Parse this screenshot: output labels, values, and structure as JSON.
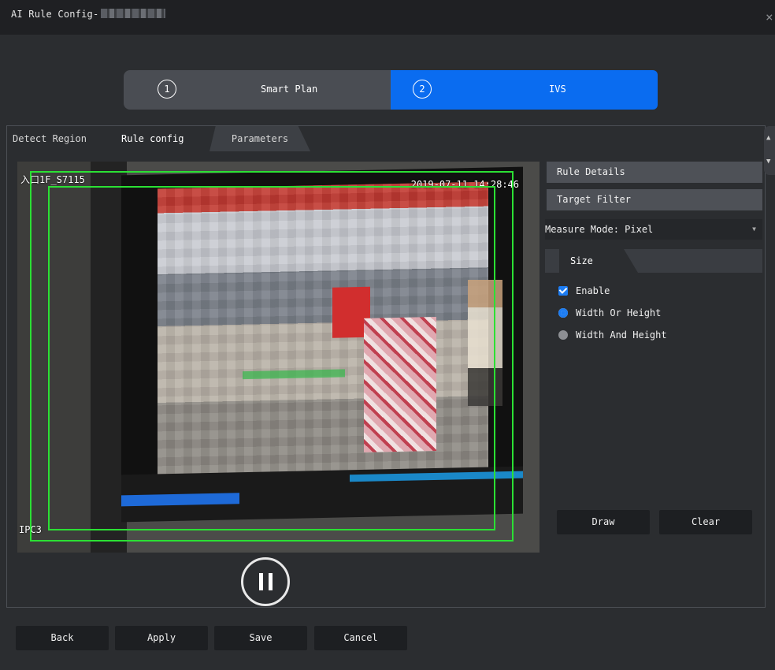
{
  "window": {
    "title": "AI Rule Config-",
    "close_glyph": "×"
  },
  "steps": [
    {
      "number": "1",
      "label": "Smart Plan"
    },
    {
      "number": "2",
      "label": "IVS"
    }
  ],
  "tabs": {
    "detect_region": "Detect Region",
    "rule_config": "Rule config",
    "parameters": "Parameters"
  },
  "video": {
    "osd_left": "入口1F_S7115",
    "osd_right": "2019-07-11 14:28:46",
    "osd_bottom": "IPC3",
    "state": "paused"
  },
  "panel": {
    "rule_details": "Rule Details",
    "target_filter": "Target Filter",
    "measure_mode": "Measure Mode: Pixel",
    "size_tab": "Size",
    "enable_label": "Enable",
    "enable_checked": true,
    "width_or_height_label": "Width Or Height",
    "width_or_height_selected": true,
    "width_and_height_label": "Width And Height",
    "width_and_height_selected": false,
    "draw_label": "Draw",
    "clear_label": "Clear"
  },
  "footer": {
    "back": "Back",
    "apply": "Apply",
    "save": "Save",
    "cancel": "Cancel"
  },
  "colors": {
    "accent": "#0a6cf0",
    "roi_box": "#2be034",
    "background": "#2b2d30"
  }
}
